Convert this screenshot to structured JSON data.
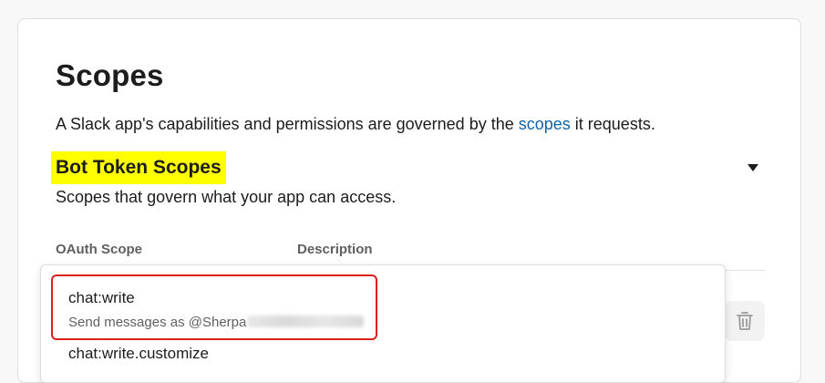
{
  "scopes": {
    "title": "Scopes",
    "intro_before": "A Slack app's capabilities and permissions are governed by the ",
    "intro_link": "scopes",
    "intro_after": " it requests."
  },
  "bot_token": {
    "title": "Bot Token Scopes",
    "subtitle": "Scopes that govern what your app can access."
  },
  "table": {
    "col_scope": "OAuth Scope",
    "col_description": "Description"
  },
  "dropdown": {
    "options": [
      {
        "name": "chat:write",
        "description": "Send messages as @Sherpa"
      },
      {
        "name": "chat:write.customize"
      }
    ]
  },
  "colors": {
    "link": "#1264a3",
    "highlight_bg": "#ffff00",
    "annotation_border": "#e01e1e"
  },
  "icons": {
    "collapse": "caret-down-icon",
    "delete": "trash-icon"
  }
}
